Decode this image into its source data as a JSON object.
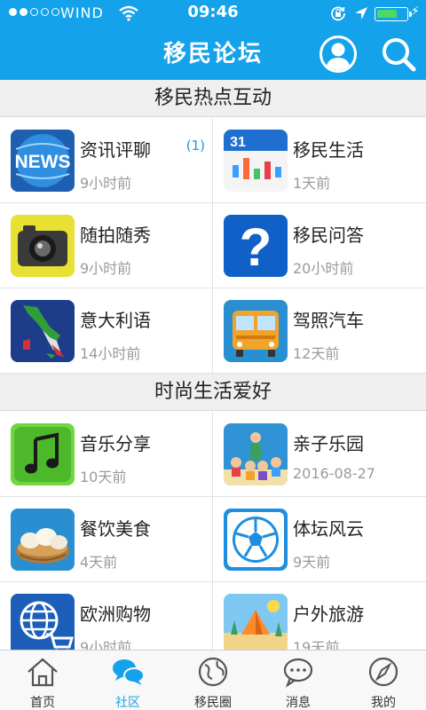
{
  "status_bar": {
    "carrier": "WIND",
    "time": "09:46",
    "signal_dots_filled": 2,
    "signal_dots_total": 5,
    "battery_level": 0.6
  },
  "header": {
    "title": "移民论坛",
    "user_icon": "user-icon",
    "search_icon": "search-icon"
  },
  "sections": [
    {
      "title": "移民热点互动",
      "items": [
        {
          "name": "资讯评聊",
          "time": "9小时前",
          "count": "(1)",
          "icon": "news-icon"
        },
        {
          "name": "移民生活",
          "time": "1天前",
          "icon": "calendar-icon"
        },
        {
          "name": "随拍随秀",
          "time": "9小时前",
          "icon": "camera-icon"
        },
        {
          "name": "移民问答",
          "time": "20小时前",
          "icon": "question-icon"
        },
        {
          "name": "意大利语",
          "time": "14小时前",
          "icon": "italy-map-icon"
        },
        {
          "name": "驾照汽车",
          "time": "12天前",
          "icon": "bus-icon"
        }
      ]
    },
    {
      "title": "时尚生活爱好",
      "items": [
        {
          "name": "音乐分享",
          "time": "10天前",
          "icon": "music-icon"
        },
        {
          "name": "亲子乐园",
          "time": "2016-08-27",
          "icon": "kids-icon"
        },
        {
          "name": "餐饮美食",
          "time": "4天前",
          "icon": "dumpling-icon"
        },
        {
          "name": "体坛风云",
          "time": "9天前",
          "icon": "soccer-icon"
        },
        {
          "name": "欧洲购物",
          "time": "9小时前",
          "icon": "shopping-cart-icon"
        },
        {
          "name": "户外旅游",
          "time": "19天前",
          "icon": "camping-icon"
        }
      ]
    }
  ],
  "tabbar": [
    {
      "label": "首页",
      "icon": "home-icon",
      "active": false
    },
    {
      "label": "社区",
      "icon": "chat-bubbles-icon",
      "active": true
    },
    {
      "label": "移民圈",
      "icon": "globe-icon",
      "active": false
    },
    {
      "label": "消息",
      "icon": "message-icon",
      "active": false
    },
    {
      "label": "我的",
      "icon": "compass-icon",
      "active": false
    }
  ],
  "colors": {
    "brand": "#14a2eb",
    "section_bg": "#efefef",
    "muted_text": "#9a9a9a",
    "count_text": "#1a95e0"
  }
}
